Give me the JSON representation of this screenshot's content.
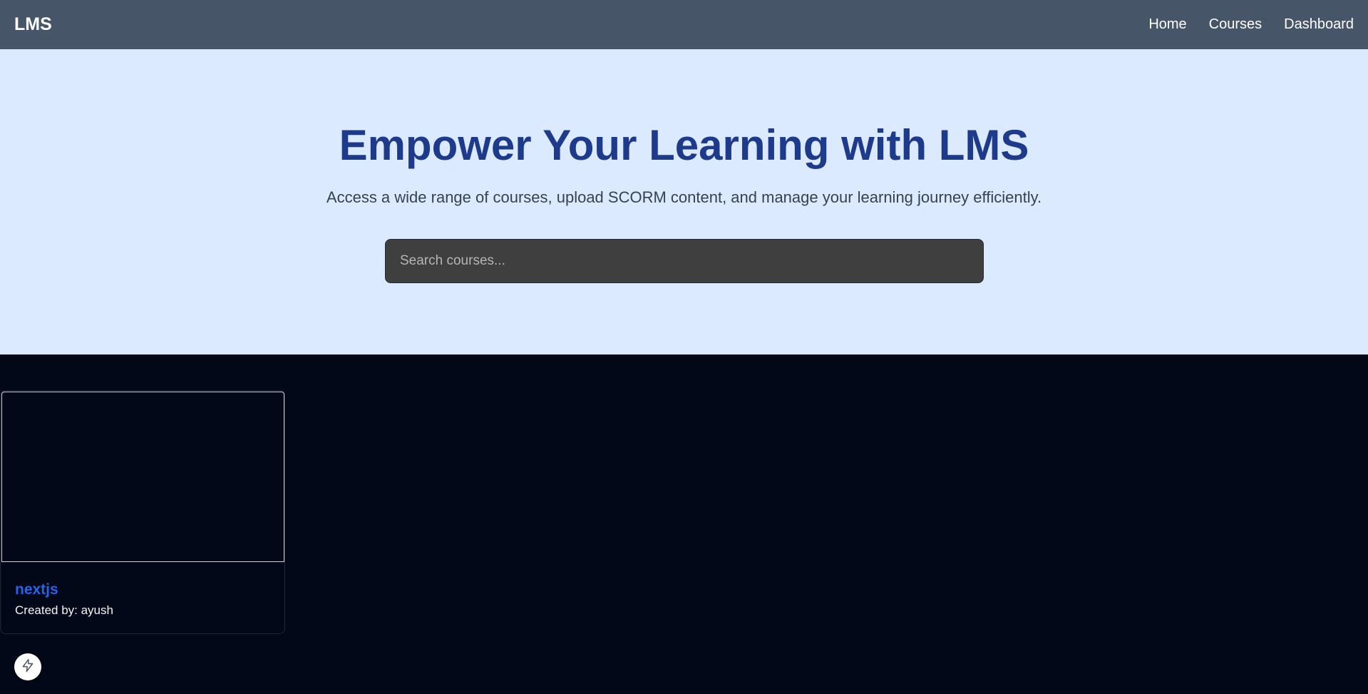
{
  "navbar": {
    "brand": "LMS",
    "links": [
      "Home",
      "Courses",
      "Dashboard"
    ]
  },
  "hero": {
    "title": "Empower Your Learning with LMS",
    "subtitle": "Access a wide range of courses, upload SCORM content, and manage your learning journey efficiently.",
    "search_placeholder": "Search courses..."
  },
  "courses": [
    {
      "title": "nextjs",
      "author": "Created by: ayush"
    }
  ],
  "fab": {
    "icon": "lightning-icon"
  },
  "colors": {
    "navbar_bg": "#475569",
    "hero_bg": "#dbeafe",
    "title": "#1e3a8a",
    "page_bg": "#030818",
    "course_title": "#2563eb",
    "search_bg": "#3f3f3f"
  }
}
